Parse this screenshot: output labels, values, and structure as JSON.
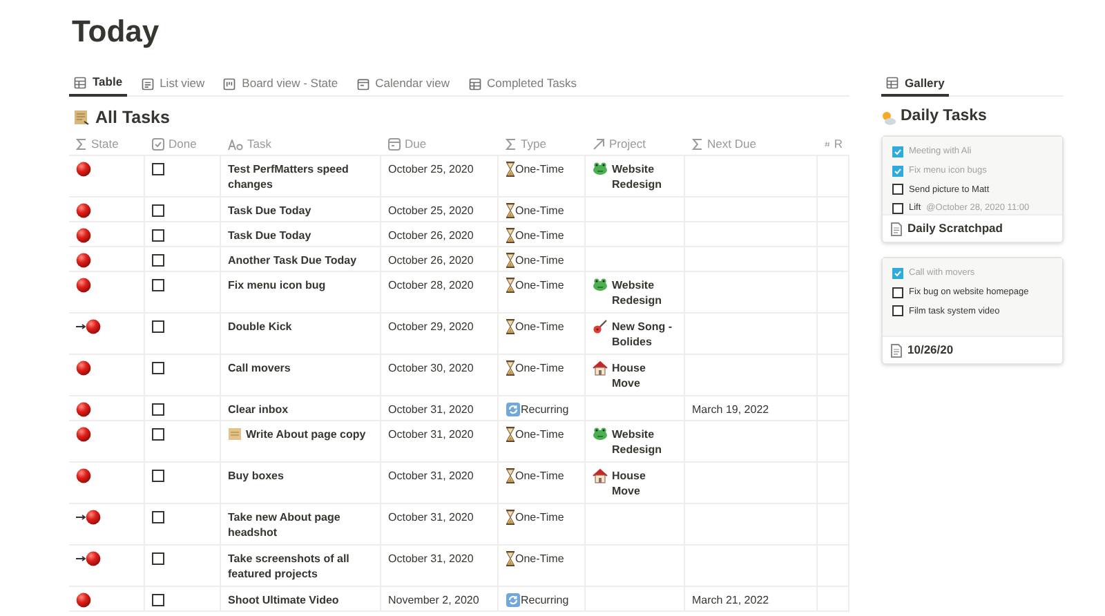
{
  "page_title": "Today",
  "tabs": [
    {
      "label": "Table",
      "kind": "table",
      "selected": true
    },
    {
      "label": "List view",
      "kind": "list",
      "selected": false
    },
    {
      "label": "Board view - State",
      "kind": "board",
      "selected": false
    },
    {
      "label": "Calendar view",
      "kind": "calendar",
      "selected": false
    },
    {
      "label": "Completed Tasks",
      "kind": "table",
      "selected": false
    }
  ],
  "table_title": "All Tasks",
  "columns": [
    {
      "label": "State",
      "kind": "formula"
    },
    {
      "label": "Done",
      "kind": "checkbox"
    },
    {
      "label": "Task",
      "kind": "text"
    },
    {
      "label": "Due",
      "kind": "date"
    },
    {
      "label": "Type",
      "kind": "formula"
    },
    {
      "label": "Project",
      "kind": "relation"
    },
    {
      "label": "Next Due",
      "kind": "formula"
    },
    {
      "label": "R",
      "kind": "number"
    }
  ],
  "rows": [
    {
      "arrow": false,
      "done": false,
      "task": "Test PerfMatters speed changes",
      "due": "October 25, 2020",
      "type": {
        "kind": "one-time",
        "label": "One-Time"
      },
      "project": {
        "kind": "frog",
        "name": "Website Redesign"
      }
    },
    {
      "arrow": false,
      "done": false,
      "task": "Task Due Today",
      "due": "October 25, 2020",
      "type": {
        "kind": "one-time",
        "label": "One-Time"
      }
    },
    {
      "arrow": false,
      "done": false,
      "task": "Task Due Today",
      "due": "October 26, 2020",
      "type": {
        "kind": "one-time",
        "label": "One-Time"
      }
    },
    {
      "arrow": false,
      "done": false,
      "task": "Another Task Due Today",
      "due": "October 26, 2020",
      "type": {
        "kind": "one-time",
        "label": "One-Time"
      }
    },
    {
      "arrow": false,
      "done": false,
      "task": "Fix menu icon bug",
      "due": "October 28, 2020",
      "type": {
        "kind": "one-time",
        "label": "One-Time"
      },
      "project": {
        "kind": "frog",
        "name": "Website Redesign"
      }
    },
    {
      "arrow": true,
      "done": false,
      "task": "Double Kick",
      "due": "October 29, 2020",
      "type": {
        "kind": "one-time",
        "label": "One-Time"
      },
      "project": {
        "kind": "guitar",
        "name": "New Song - Bolides"
      }
    },
    {
      "arrow": false,
      "done": false,
      "task": "Call movers",
      "due": "October 30, 2020",
      "type": {
        "kind": "one-time",
        "label": "One-Time"
      },
      "project": {
        "kind": "house",
        "name": "House Move"
      }
    },
    {
      "arrow": false,
      "done": false,
      "task": "Clear inbox",
      "due": "October 31, 2020",
      "type": {
        "kind": "recurring",
        "label": "Recurring"
      },
      "next_due": "March 19, 2022"
    },
    {
      "arrow": false,
      "done": false,
      "task": "Write About page copy",
      "has_icon": true,
      "due": "October 31, 2020",
      "type": {
        "kind": "one-time",
        "label": "One-Time"
      },
      "project": {
        "kind": "frog",
        "name": "Website Redesign"
      }
    },
    {
      "arrow": false,
      "done": false,
      "task": "Buy boxes",
      "due": "October 31, 2020",
      "type": {
        "kind": "one-time",
        "label": "One-Time"
      },
      "project": {
        "kind": "house",
        "name": "House Move"
      }
    },
    {
      "arrow": true,
      "done": false,
      "task": "Take new About page headshot",
      "due": "October 31, 2020",
      "type": {
        "kind": "one-time",
        "label": "One-Time"
      }
    },
    {
      "arrow": true,
      "done": false,
      "task": "Take screenshots of all featured projects",
      "due": "October 31, 2020",
      "type": {
        "kind": "one-time",
        "label": "One-Time"
      }
    },
    {
      "arrow": false,
      "done": false,
      "task": "Shoot Ultimate Video",
      "due": "November 2, 2020",
      "type": {
        "kind": "recurring",
        "label": "Recurring"
      },
      "next_due": "March 21, 2022"
    }
  ],
  "side_tabs": [
    {
      "label": "Gallery",
      "selected": true
    }
  ],
  "side_title": "Daily Tasks",
  "cards": [
    {
      "items": [
        {
          "text": "Meeting with Ali",
          "checked": true
        },
        {
          "text": "Fix menu icon bugs",
          "checked": true
        },
        {
          "text": "Send picture to Matt",
          "checked": false
        },
        {
          "text": "Lift",
          "date": "@October 28, 2020 11:00",
          "checked": false
        }
      ],
      "title": "Daily Scratchpad"
    },
    {
      "items": [
        {
          "text": "Call with movers",
          "checked": true
        },
        {
          "text": "Fix bug on website homepage",
          "checked": false
        },
        {
          "text": "Film task system video",
          "checked": false
        }
      ],
      "title": "10/26/20"
    }
  ]
}
